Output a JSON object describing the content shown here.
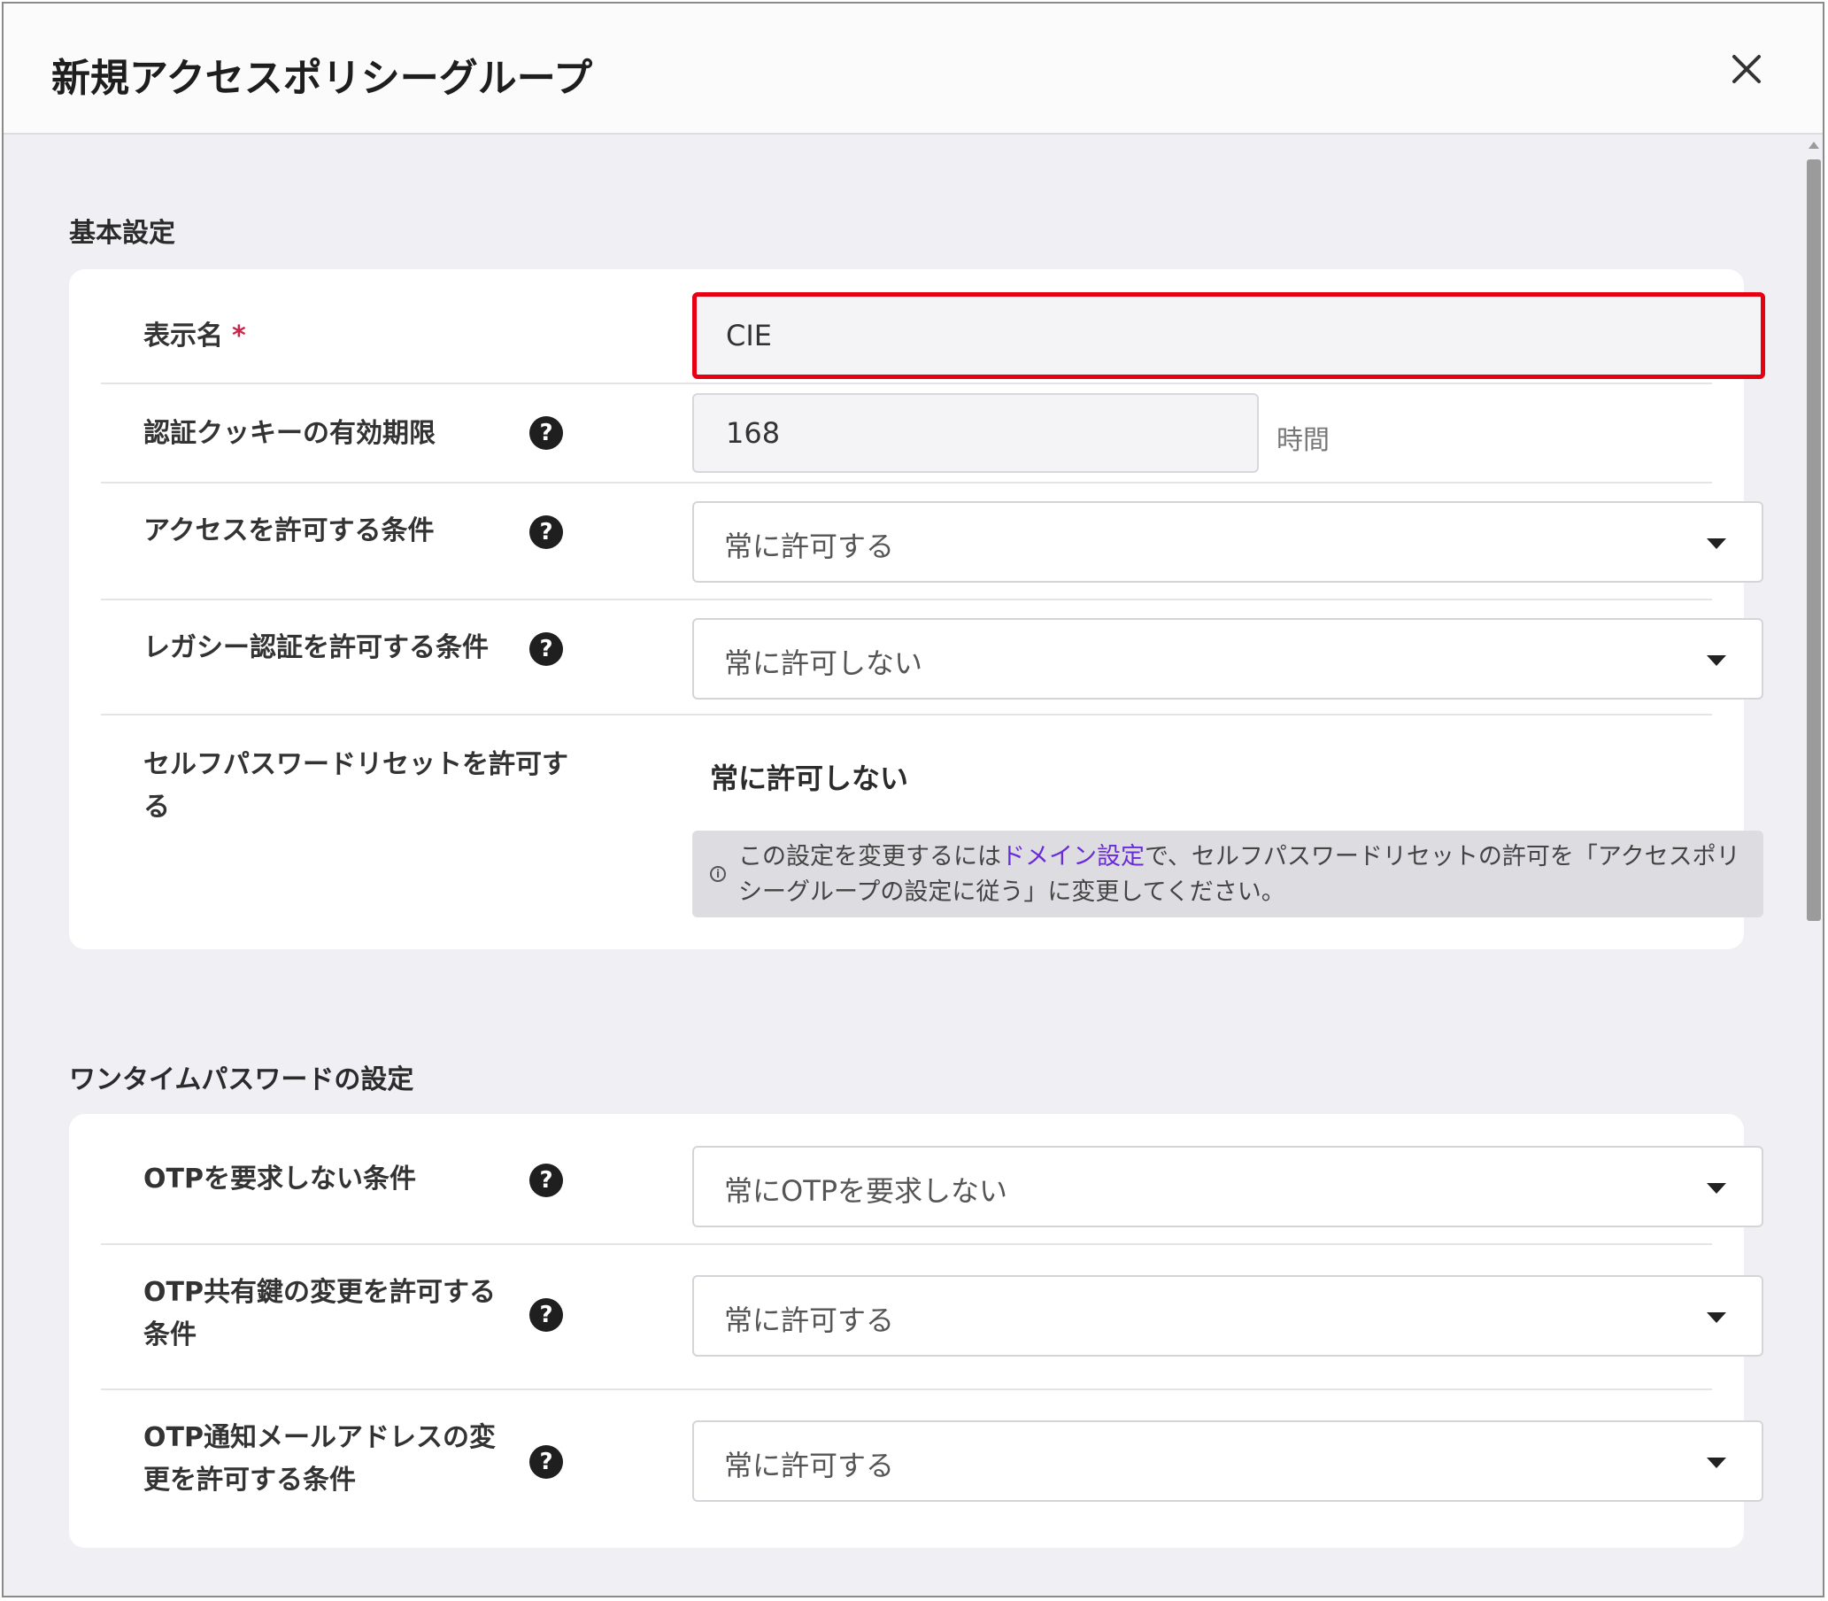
{
  "dialog": {
    "title": "新規アクセスポリシーグループ",
    "close_icon": "close-icon"
  },
  "basic": {
    "section_title": "基本設定",
    "display_name": {
      "label": "表示名",
      "required_mark": "*",
      "value": "CIE"
    },
    "cookie_expiry": {
      "label": "認証クッキーの有効期限",
      "value": "168",
      "unit": "時間"
    },
    "access_condition": {
      "label": "アクセスを許可する条件",
      "value": "常に許可する"
    },
    "legacy_auth": {
      "label": "レガシー認証を許可する条件",
      "value": "常に許可しない"
    },
    "self_reset": {
      "label": "セルフパスワードリセットを許可する",
      "value": "常に許可しない",
      "info_prefix": "この設定を変更するには",
      "info_link": "ドメイン設定",
      "info_suffix": "で、セルフパスワードリセットの許可を「アクセスポリシーグループの設定に従う」に変更してください。"
    }
  },
  "otp": {
    "section_title": "ワンタイムパスワードの設定",
    "not_required": {
      "label": "OTPを要求しない条件",
      "value": "常にOTPを要求しない"
    },
    "shared_key_change": {
      "label": "OTP共有鍵の変更を許可する条件",
      "value": "常に許可する"
    },
    "email_change": {
      "label": "OTP通知メールアドレスの変更を許可する条件",
      "value": "常に許可する"
    }
  },
  "help_glyph": "?",
  "info_glyph": "i",
  "colors": {
    "highlight": "#e60012",
    "link": "#6a2bd8",
    "required": "#c8264a"
  }
}
